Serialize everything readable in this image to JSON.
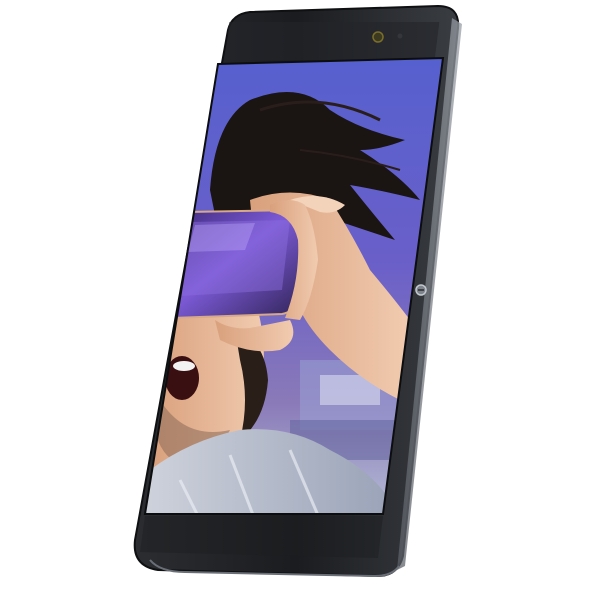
{
  "scene": {
    "subject": "smartphone-product-photo",
    "colors": {
      "background": "#ffffff",
      "phone_body": "#1d1f22",
      "phone_edge": "#4a4d52",
      "screen_sky": "#4b56c8",
      "skin": "#e8b89a",
      "hair": "#1a1412",
      "vr_headset": "#6b4fc8"
    },
    "icons": [
      "front-camera-icon",
      "sensor-icon",
      "side-button-icon"
    ]
  }
}
